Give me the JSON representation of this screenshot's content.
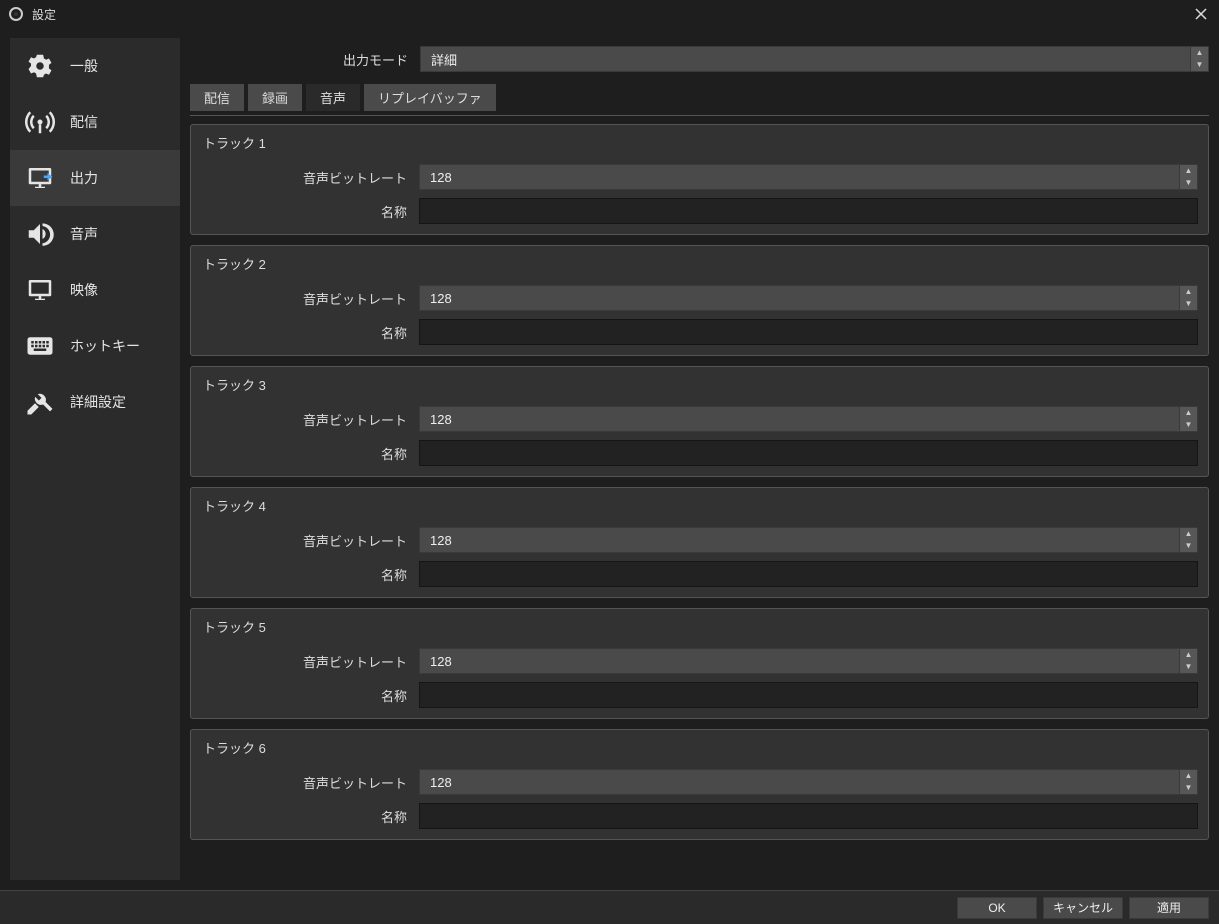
{
  "window": {
    "title": "設定"
  },
  "sidebar": {
    "items": [
      {
        "label": "一般"
      },
      {
        "label": "配信"
      },
      {
        "label": "出力"
      },
      {
        "label": "音声"
      },
      {
        "label": "映像"
      },
      {
        "label": "ホットキー"
      },
      {
        "label": "詳細設定"
      }
    ],
    "active_index": 2
  },
  "output_mode": {
    "label": "出力モード",
    "value": "詳細"
  },
  "tabs": {
    "items": [
      {
        "label": "配信"
      },
      {
        "label": "録画"
      },
      {
        "label": "音声"
      },
      {
        "label": "リプレイバッファ"
      }
    ],
    "active_index": 2
  },
  "field_labels": {
    "bitrate": "音声ビットレート",
    "name": "名称"
  },
  "tracks": [
    {
      "title": "トラック 1",
      "bitrate": "128",
      "name": ""
    },
    {
      "title": "トラック 2",
      "bitrate": "128",
      "name": ""
    },
    {
      "title": "トラック 3",
      "bitrate": "128",
      "name": ""
    },
    {
      "title": "トラック 4",
      "bitrate": "128",
      "name": ""
    },
    {
      "title": "トラック 5",
      "bitrate": "128",
      "name": ""
    },
    {
      "title": "トラック 6",
      "bitrate": "128",
      "name": ""
    }
  ],
  "footer": {
    "ok": "OK",
    "cancel": "キャンセル",
    "apply": "適用"
  }
}
